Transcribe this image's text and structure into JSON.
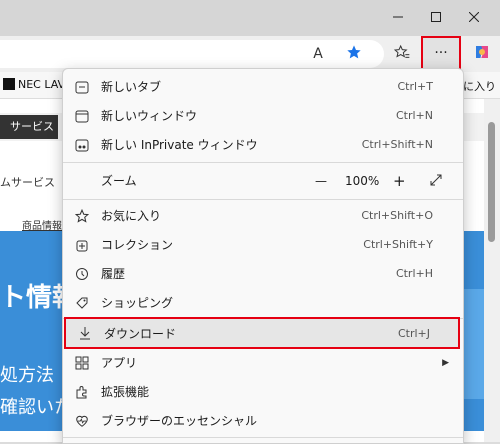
{
  "window": {
    "minimize_icon": "minimize-icon",
    "maximize_icon": "maximize-icon",
    "close_icon": "close-icon"
  },
  "toolbar": {
    "read_aloud_label": "A",
    "more_label": "···"
  },
  "favorites_bar": {
    "site_label": "NEC LAV",
    "favorites_label": "に入り"
  },
  "page": {
    "nav_button": "サービス",
    "nav_text": "ムサービス",
    "link_text": "商品情報",
    "hero_line1": "ト情報",
    "hero_line2": "処方法",
    "hero_line3": "確認いた",
    "side_chars": "C"
  },
  "menu": {
    "items": [
      {
        "label": "新しいタブ",
        "shortcut": "Ctrl+T",
        "icon": "new-tab-icon"
      },
      {
        "label": "新しいウィンドウ",
        "shortcut": "Ctrl+N",
        "icon": "new-window-icon"
      },
      {
        "label": "新しい InPrivate ウィンドウ",
        "shortcut": "Ctrl+Shift+N",
        "icon": "inprivate-icon"
      },
      {
        "label": "ズーム",
        "zoom_value": "100%",
        "minus": "—",
        "plus": "+"
      },
      {
        "label": "お気に入り",
        "shortcut": "Ctrl+Shift+O",
        "icon": "star-icon"
      },
      {
        "label": "コレクション",
        "shortcut": "Ctrl+Shift+Y",
        "icon": "collections-icon"
      },
      {
        "label": "履歴",
        "shortcut": "Ctrl+H",
        "icon": "history-icon"
      },
      {
        "label": "ショッピング",
        "shortcut": "",
        "icon": "tag-icon"
      },
      {
        "label": "ダウンロード",
        "shortcut": "Ctrl+J",
        "icon": "download-icon"
      },
      {
        "label": "アプリ",
        "shortcut": "",
        "icon": "apps-icon"
      },
      {
        "label": "拡張機能",
        "shortcut": "",
        "icon": "extensions-icon"
      },
      {
        "label": "ブラウザーのエッセンシャル",
        "shortcut": "",
        "icon": "heartbeat-icon"
      }
    ]
  },
  "colors": {
    "highlight_border": "#e60012",
    "hero_blue": "#3a8ed8",
    "star_blue": "#1a73e8"
  }
}
